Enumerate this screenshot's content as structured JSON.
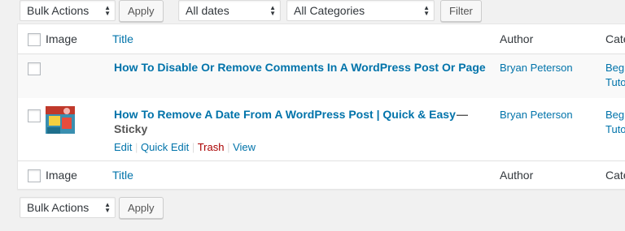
{
  "top_filters": {
    "bulk_actions": "Bulk Actions",
    "apply": "Apply",
    "dates": "All dates",
    "categories": "All Categories",
    "filter": "Filter"
  },
  "table": {
    "columns": {
      "image": "Image",
      "title": "Title",
      "author": "Author",
      "categories": "Cate"
    },
    "rows": [
      {
        "title": "How To Disable Or Remove Comments In A WordPress Post Or Page",
        "author": "Bryan Peterson",
        "cat_line1": "Beg",
        "cat_line2": "Tuto"
      },
      {
        "title": "How To Remove A Date From A WordPress Post | Quick & Easy",
        "state_sep": "—",
        "state": "Sticky",
        "author": "Bryan Peterson",
        "cat_line1": "Beg",
        "cat_line2": "Tuto",
        "actions": {
          "edit": "Edit",
          "quick_edit": "Quick Edit",
          "trash": "Trash",
          "view": "View",
          "sep": "|"
        }
      }
    ]
  },
  "bottom_filters": {
    "bulk_actions": "Bulk Actions",
    "apply": "Apply"
  },
  "colors": {
    "link": "#0073aa",
    "trash": "#a00000",
    "background": "#f1f1f1"
  }
}
